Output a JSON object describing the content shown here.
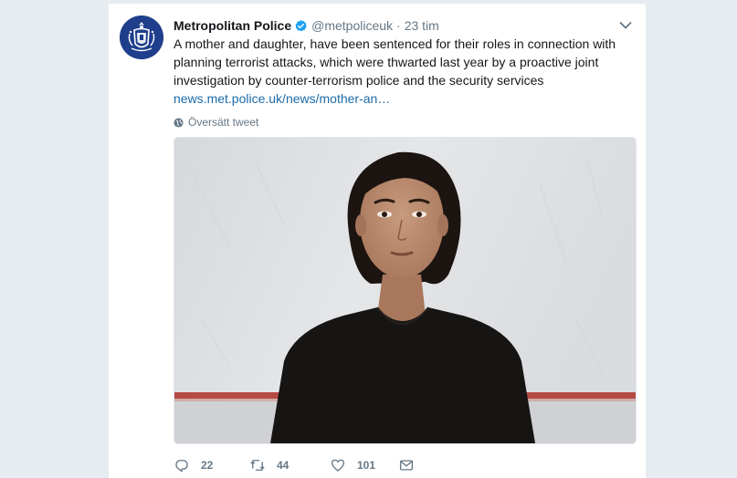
{
  "tweet": {
    "display_name": "Metropolitan Police",
    "verified": true,
    "handle": "@metpoliceuk",
    "separator": "·",
    "time": "23 tim",
    "text_lines": [
      "A mother and daughter, have been sentenced for their roles in connection with",
      "planning terrorist attacks, which were thwarted last year by a proactive joint",
      "investigation by counter-terrorism police and the security services"
    ],
    "link_text": "news.met.police.uk/news/mother-an…",
    "translate_label": "Översätt tweet"
  },
  "actions": {
    "reply_count": "22",
    "retweet_count": "44",
    "like_count": "101"
  },
  "icons": {
    "verified": "verified-badge-icon",
    "caret": "chevron-down-icon",
    "globe": "globe-icon",
    "reply": "reply-icon",
    "retweet": "retweet-icon",
    "like": "heart-icon",
    "message": "envelope-icon"
  },
  "colors": {
    "background": "#e6ecf0",
    "link": "#1c6aa8",
    "verified": "#1da1f2",
    "muted": "#657786",
    "avatar_bg": "#1f3f8c"
  }
}
